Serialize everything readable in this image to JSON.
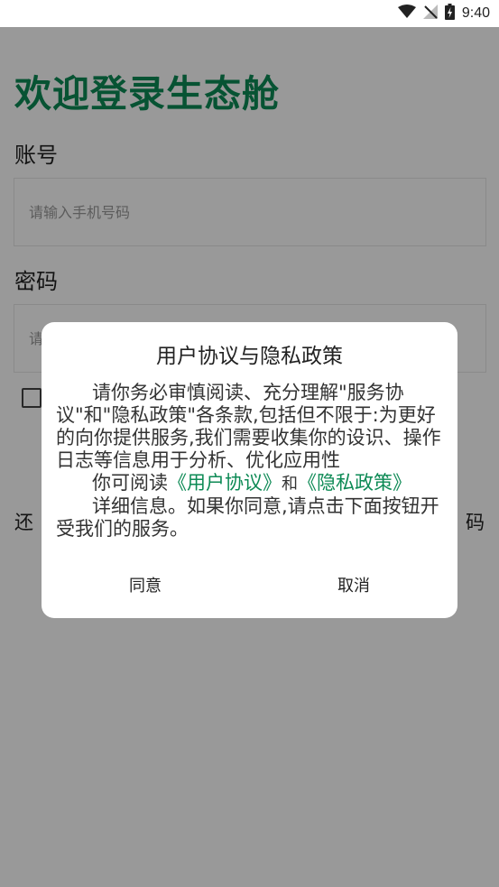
{
  "status_bar": {
    "time": "9:40"
  },
  "login": {
    "title": "欢迎登录生态舱",
    "account_label": "账号",
    "account_placeholder": "请输入手机号码",
    "password_label": "密码",
    "password_placeholder": "请",
    "other_login_partial": "还",
    "forgot_password_partial": "码"
  },
  "dialog": {
    "title": "用户协议与隐私政策",
    "paragraph1": "请你务必审慎阅读、充分理解\"服务协议\"和\"隐私政策\"各条款,包括但不限于:为更好的向你提供服务,我们需要收集你的设识、操作日志等信息用于分析、优化应用性",
    "read_prefix": "你可阅读",
    "user_agreement_link": "《用户协议》",
    "and_text": "和",
    "privacy_link": "《隐私政策》",
    "paragraph3": "详细信息。如果你同意,请点击下面按钮开受我们的服务。",
    "agree_label": "同意",
    "cancel_label": "取消"
  },
  "colors": {
    "accent": "#0d8a55",
    "overlay": "rgba(0,0,0,0.40)"
  }
}
